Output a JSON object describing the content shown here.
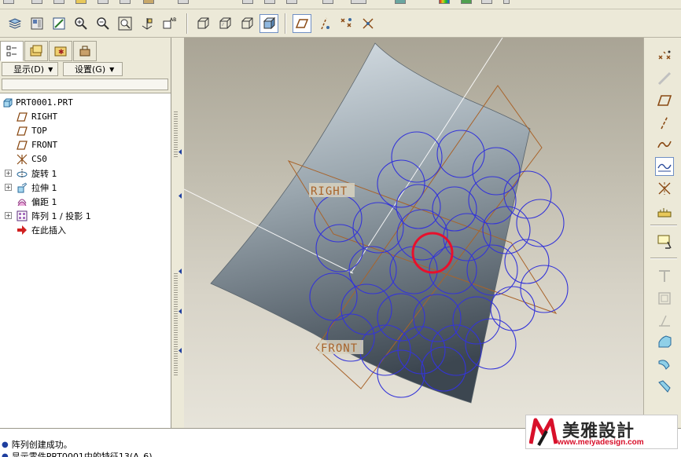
{
  "window": {
    "title": ""
  },
  "left_panel": {
    "menus": [
      {
        "label": "显示(D)"
      },
      {
        "label": "设置(G)"
      }
    ],
    "tree": [
      {
        "label": "PRT0001.PRT",
        "icon": "part-icon"
      },
      {
        "label": "RIGHT",
        "icon": "datum-plane-icon"
      },
      {
        "label": "TOP",
        "icon": "datum-plane-icon"
      },
      {
        "label": "FRONT",
        "icon": "datum-plane-icon"
      },
      {
        "label": "CS0",
        "icon": "coordinate-system-icon"
      },
      {
        "label": "旋转 1",
        "icon": "revolve-icon"
      },
      {
        "label": "拉伸 1",
        "icon": "extrude-icon"
      },
      {
        "label": "偏距 1",
        "icon": "offset-icon"
      },
      {
        "label": "阵列 1 / 投影 1",
        "icon": "pattern-icon"
      },
      {
        "label": "在此插入",
        "icon": "insert-here-arrow-icon"
      }
    ]
  },
  "viewport": {
    "datum_labels": {
      "right": "RIGHT",
      "front": "FRONT"
    }
  },
  "messages": [
    "阵列创建成功。",
    "显示零件PRT0001中的特征13(A_6)"
  ],
  "watermark": {
    "brand": "美雅設計",
    "url": "www.meiyadesign.com"
  },
  "colors": {
    "pattern_circle": "#3434d8",
    "selected_circle": "#e8102c",
    "datum_plane": "#a8632a",
    "surface_light": "#c9d3dc",
    "surface_dark": "#3c4650"
  }
}
